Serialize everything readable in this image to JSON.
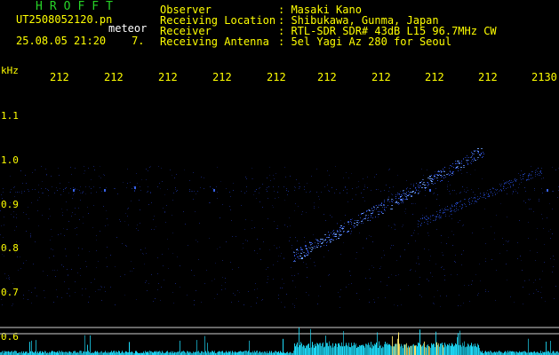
{
  "header": {
    "brand": "HROFFT",
    "filename": "UT2508052120.pn",
    "tag": "meteor",
    "timestamp": "25.08.05 21:20",
    "marker": "7.",
    "fields": [
      {
        "label": "Observer",
        "value": ": Masaki Kano"
      },
      {
        "label": "Receiving Location",
        "value": ": Shibukawa, Gunma, Japan"
      },
      {
        "label": "Receiver",
        "value": ": RTL-SDR SDR# 43dB L15 96.7MHz CW"
      },
      {
        "label": "Receiving Antenna",
        "value": ": 5el Yagi Az 280 for Seoul"
      }
    ]
  },
  "axes": {
    "y_unit": "kHz",
    "x_ticks": [
      "212",
      "212",
      "212",
      "212",
      "212",
      "212",
      "212",
      "212",
      "212",
      "2130"
    ],
    "y_ticks": [
      "1.1",
      "1.0",
      "0.9",
      "0.8",
      "0.7",
      "0.6"
    ]
  },
  "colors": {
    "header_title": "#27d327",
    "labels": "#ffff00",
    "trace": "#3060ff",
    "baseline": "#00e0ff"
  }
}
